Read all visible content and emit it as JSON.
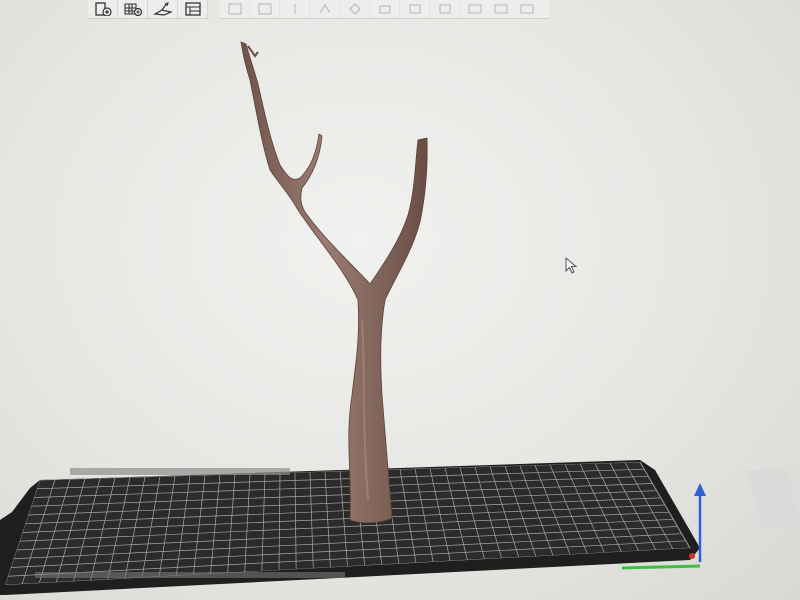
{
  "window": {
    "type": "3d-slicer-viewport"
  },
  "toolbar": {
    "buttons": [
      {
        "name": "add-file-button",
        "icon": "add-file-icon"
      },
      {
        "name": "add-plate-button",
        "icon": "add-plate-icon"
      },
      {
        "name": "orient-button",
        "icon": "orient-icon"
      },
      {
        "name": "arrange-button",
        "icon": "arrange-icon"
      }
    ],
    "faded_buttons": [
      "split-objects-icon",
      "split-parts-icon",
      "variable-layer-icon",
      "paint-seam-icon",
      "cut-icon",
      "support-paint-icon",
      "measure-icon",
      "assembly-icon"
    ]
  },
  "scene": {
    "object": "tree-branch-model",
    "build_plate": {
      "color": "#2a2a2a",
      "grid_color": "#bfbfbf"
    },
    "axes": {
      "z_color": "#2f5fd8",
      "x_color": "#3fbf3f",
      "y_origin_color": "#d83030"
    }
  },
  "colors": {
    "background": "#e6e6e3",
    "model": "#8a6d62",
    "toolbar": "#ededeb"
  }
}
